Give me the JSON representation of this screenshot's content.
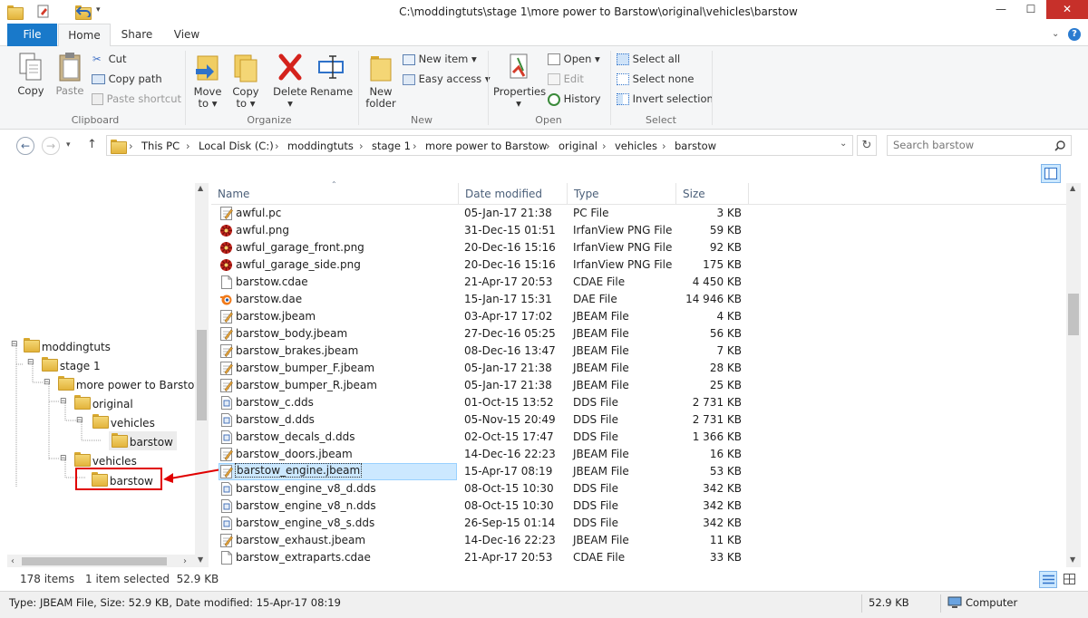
{
  "window": {
    "title": "C:\\moddingtuts\\stage 1\\more power to Barstow\\original\\vehicles\\barstow",
    "minimize": "—",
    "maximize": "☐",
    "close": "✕"
  },
  "tabs": {
    "file": "File",
    "home": "Home",
    "share": "Share",
    "view": "View"
  },
  "ribbon": {
    "clipboard": {
      "label": "Clipboard",
      "copy": "Copy",
      "paste": "Paste",
      "cut": "Cut",
      "copy_path": "Copy path",
      "paste_shortcut": "Paste shortcut"
    },
    "organize": {
      "label": "Organize",
      "move_to": "Move",
      "move_to2": "to ▾",
      "copy_to": "Copy",
      "copy_to2": "to ▾",
      "delete": "Delete",
      "delete2": "▾",
      "rename": "Rename"
    },
    "new": {
      "label": "New",
      "new_folder": "New",
      "new_folder2": "folder",
      "new_item": "New item ▾",
      "easy_access": "Easy access ▾"
    },
    "open": {
      "label": "Open",
      "properties": "Properties",
      "properties2": "▾",
      "open": "Open ▾",
      "edit": "Edit",
      "history": "History"
    },
    "select": {
      "label": "Select",
      "select_all": "Select all",
      "select_none": "Select none",
      "invert": "Invert selection"
    }
  },
  "address": {
    "crumbs": [
      "This PC",
      "Local Disk (C:)",
      "moddingtuts",
      "stage 1",
      "more power to Barstow",
      "original",
      "vehicles",
      "barstow"
    ],
    "search_placeholder": "Search barstow"
  },
  "tree": [
    "moddingtuts",
    "stage 1",
    "more power to Barstow",
    "original",
    "vehicles",
    "barstow",
    "vehicles",
    "barstow"
  ],
  "columns": {
    "name": "Name",
    "date": "Date modified",
    "type": "Type",
    "size": "Size"
  },
  "files": [
    {
      "name": "awful.pc",
      "date": "05-Jan-17 21:38",
      "type": "PC File",
      "size": "3 KB",
      "icon": "text"
    },
    {
      "name": "awful.png",
      "date": "31-Dec-15 01:51",
      "type": "IrfanView PNG File",
      "size": "59 KB",
      "icon": "irfan"
    },
    {
      "name": "awful_garage_front.png",
      "date": "20-Dec-16 15:16",
      "type": "IrfanView PNG File",
      "size": "92 KB",
      "icon": "irfan"
    },
    {
      "name": "awful_garage_side.png",
      "date": "20-Dec-16 15:16",
      "type": "IrfanView PNG File",
      "size": "175 KB",
      "icon": "irfan"
    },
    {
      "name": "barstow.cdae",
      "date": "21-Apr-17 20:53",
      "type": "CDAE File",
      "size": "4 450 KB",
      "icon": "blank"
    },
    {
      "name": "barstow.dae",
      "date": "15-Jan-17 15:31",
      "type": "DAE File",
      "size": "14 946 KB",
      "icon": "blender"
    },
    {
      "name": "barstow.jbeam",
      "date": "03-Apr-17 17:02",
      "type": "JBEAM File",
      "size": "4 KB",
      "icon": "text"
    },
    {
      "name": "barstow_body.jbeam",
      "date": "27-Dec-16 05:25",
      "type": "JBEAM File",
      "size": "56 KB",
      "icon": "text"
    },
    {
      "name": "barstow_brakes.jbeam",
      "date": "08-Dec-16 13:47",
      "type": "JBEAM File",
      "size": "7 KB",
      "icon": "text"
    },
    {
      "name": "barstow_bumper_F.jbeam",
      "date": "05-Jan-17 21:38",
      "type": "JBEAM File",
      "size": "28 KB",
      "icon": "text"
    },
    {
      "name": "barstow_bumper_R.jbeam",
      "date": "05-Jan-17 21:38",
      "type": "JBEAM File",
      "size": "25 KB",
      "icon": "text"
    },
    {
      "name": "barstow_c.dds",
      "date": "01-Oct-15 13:52",
      "type": "DDS File",
      "size": "2 731 KB",
      "icon": "dds"
    },
    {
      "name": "barstow_d.dds",
      "date": "05-Nov-15 20:49",
      "type": "DDS File",
      "size": "2 731 KB",
      "icon": "dds"
    },
    {
      "name": "barstow_decals_d.dds",
      "date": "02-Oct-15 17:47",
      "type": "DDS File",
      "size": "1 366 KB",
      "icon": "dds"
    },
    {
      "name": "barstow_doors.jbeam",
      "date": "14-Dec-16 22:23",
      "type": "JBEAM File",
      "size": "16 KB",
      "icon": "text"
    },
    {
      "name": "barstow_engine.jbeam",
      "date": "15-Apr-17 08:19",
      "type": "JBEAM File",
      "size": "53 KB",
      "icon": "text",
      "selected": true
    },
    {
      "name": "barstow_engine_v8_d.dds",
      "date": "08-Oct-15 10:30",
      "type": "DDS File",
      "size": "342 KB",
      "icon": "dds"
    },
    {
      "name": "barstow_engine_v8_n.dds",
      "date": "08-Oct-15 10:30",
      "type": "DDS File",
      "size": "342 KB",
      "icon": "dds"
    },
    {
      "name": "barstow_engine_v8_s.dds",
      "date": "26-Sep-15 01:14",
      "type": "DDS File",
      "size": "342 KB",
      "icon": "dds"
    },
    {
      "name": "barstow_exhaust.jbeam",
      "date": "14-Dec-16 22:23",
      "type": "JBEAM File",
      "size": "11 KB",
      "icon": "text"
    },
    {
      "name": "barstow_extraparts.cdae",
      "date": "21-Apr-17 20:53",
      "type": "CDAE File",
      "size": "33 KB",
      "icon": "blank"
    }
  ],
  "status": {
    "count": "178 items",
    "selected": "1 item selected  52.9 KB"
  },
  "details": {
    "text": "Type: JBEAM File, Size: 52.9 KB, Date modified: 15-Apr-17 08:19",
    "size": "52.9 KB",
    "location": "Computer"
  },
  "colors": {
    "accent": "#1979ca",
    "selection": "#cce8ff",
    "annotation": "#e00000"
  }
}
